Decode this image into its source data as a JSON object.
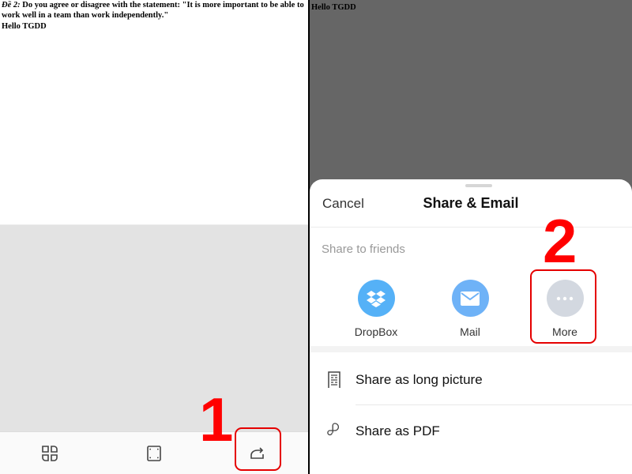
{
  "left_panel": {
    "document": {
      "prefix": "Đề 2:",
      "question": " Do you agree or disagree with the statement: \"It is more important to be able to work well in a team than work independently.\"",
      "greeting": "Hello TGDD"
    },
    "toolbar": {
      "items": [
        {
          "icon": "apps-grid-icon",
          "label": "Thumbnails"
        },
        {
          "icon": "fullscreen-frame-icon",
          "label": "Fullscreen"
        },
        {
          "icon": "share-arrow-icon",
          "label": "Share"
        }
      ]
    },
    "annotation": {
      "step": "1"
    }
  },
  "right_panel": {
    "background_text": "Hello TGDD",
    "share_sheet": {
      "cancel_label": "Cancel",
      "title": "Share & Email",
      "section_label": "Share to friends",
      "targets": [
        {
          "label": "DropBox",
          "icon": "dropbox-icon",
          "color": "#55b1f7"
        },
        {
          "label": "Mail",
          "icon": "mail-icon",
          "color": "#6eb2f7"
        },
        {
          "label": "More",
          "icon": "more-dots-icon",
          "color": "#d3d8e0"
        }
      ],
      "options": [
        {
          "label": "Share as long picture",
          "icon": "long-picture-icon"
        },
        {
          "label": "Share as PDF",
          "icon": "pdf-icon"
        }
      ]
    },
    "annotation": {
      "step": "2"
    }
  },
  "colors": {
    "annotation_red": "#ff0000",
    "overlay_gray": "#666666"
  }
}
